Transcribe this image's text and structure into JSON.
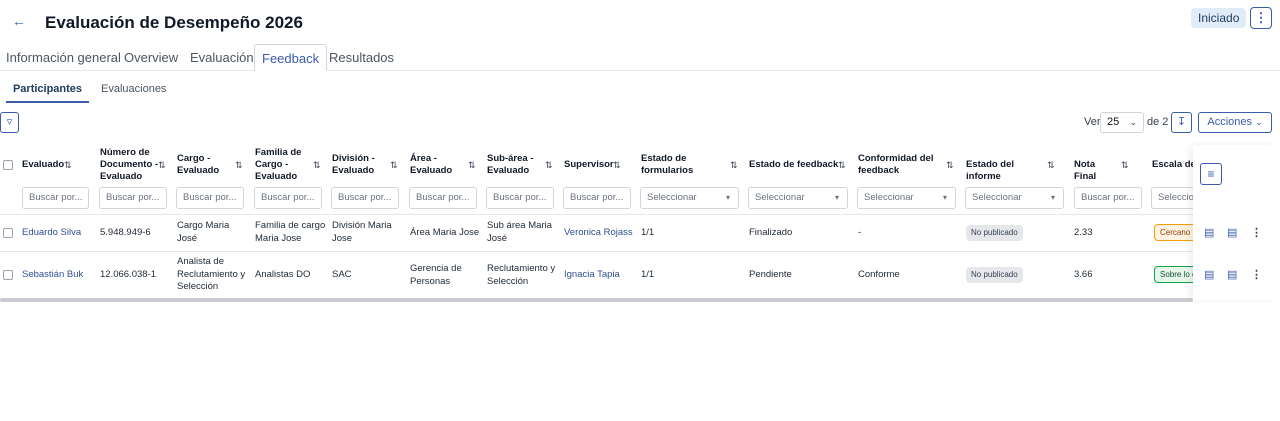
{
  "header": {
    "title": "Evaluación de Desempeño 2026",
    "status": "Iniciado"
  },
  "tabs": [
    "Información general",
    "Overview",
    "Evaluación",
    "Feedback",
    "Resultados"
  ],
  "subtabs": [
    "Participantes",
    "Evaluaciones"
  ],
  "toolbar": {
    "ver_label": "Ver",
    "page_size": "25",
    "of_pages": "de 2",
    "actions_label": "Acciones"
  },
  "columns": [
    {
      "label": "Evaluado",
      "filter": "Buscar por..."
    },
    {
      "label": "Número de Documento - Evaluado",
      "filter": "Buscar por..."
    },
    {
      "label": "Cargo - Evaluado",
      "filter": "Buscar por..."
    },
    {
      "label": "Familia de Cargo - Evaluado",
      "filter": "Buscar por..."
    },
    {
      "label": "División - Evaluado",
      "filter": "Buscar por..."
    },
    {
      "label": "Área - Evaluado",
      "filter": "Buscar por..."
    },
    {
      "label": "Sub-área - Evaluado",
      "filter": "Buscar por..."
    },
    {
      "label": "Supervisor",
      "filter": "Buscar por..."
    },
    {
      "label": "Estado de formularios",
      "filter": "Seleccionar"
    },
    {
      "label": "Estado de feedback",
      "filter": "Seleccionar"
    },
    {
      "label": "Conformidad del feedback",
      "filter": "Seleccionar"
    },
    {
      "label": "Estado del informe",
      "filter": "Seleccionar"
    },
    {
      "label": "Nota Final",
      "filter": "Buscar por..."
    },
    {
      "label": "Escala de N",
      "filter": "Seleccion"
    }
  ],
  "rows": [
    {
      "evaluado": "Eduardo Silva",
      "documento": "5.948.949-6",
      "cargo": "Cargo Maria José",
      "familia": "Familia de cargo Maria Jose",
      "division": "División Maria Jose",
      "area": "Área Maria Jose",
      "subarea": "Sub área Maria José",
      "supervisor": "Veronica Rojass",
      "formularios": "1/1",
      "feedback": "Finalizado",
      "conformidad": "-",
      "informe": "No publicado",
      "nota": "2.33",
      "escala": "Cercano a"
    },
    {
      "evaluado": "Sebastián Buk",
      "documento": "12.066.038-1",
      "cargo": "Analista de Reclutamiento y Selección",
      "familia": "Analistas DO",
      "division": "SAC",
      "area": "Gerencia de Personas",
      "subarea": "Reclutamiento y Selección",
      "supervisor": "Ignacia Tapia",
      "formularios": "1/1",
      "feedback": "Pendiente",
      "conformidad": "Conforme",
      "informe": "No publicado",
      "nota": "3.66",
      "escala": "Sobre lo e"
    }
  ],
  "colors": {
    "accent": "#3b5bab",
    "scale_orange": "#f59e0b",
    "scale_green": "#16a34a"
  }
}
